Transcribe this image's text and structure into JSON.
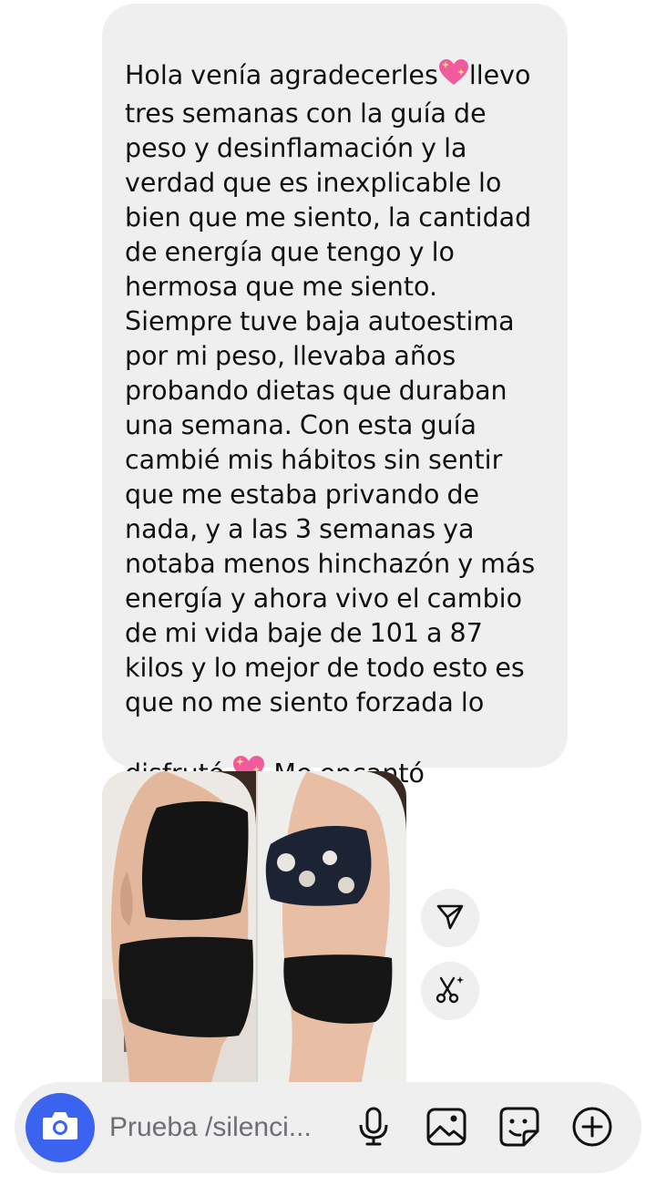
{
  "message": {
    "text_before_emoji1": "Hola venía agradecerles",
    "text_after_emoji1": "llevo\ntres semanas con la guía de\npeso y desinflamación y la\nverdad que es inexplicable lo\nbien que me siento, la cantidad\nde energía que tengo y lo\nhermosa que me siento.\nSiempre tuve baja autoestima\npor mi peso, llevaba años\nprobando dietas que duraban\nuna semana. Con esta guía\ncambié mis hábitos sin sentir\nque me estaba privando de\nnada, y a las 3 semanas ya\nnotaba menos hinchazón y más\nenergía y ahora vivo el cambio\nde mi vida baje de 101 a 87\nkilos y lo mejor de todo esto es\nque no me siento forzada lo\ndisfrutó ",
    "text_after_emoji2": " Me encantó",
    "emoji": "💖",
    "trailing": "—"
  },
  "photo": {
    "icon": "before-after-photo"
  },
  "side_actions": {
    "share_icon": "send-icon",
    "edit_icon": "scissors-sparkle-icon"
  },
  "composer": {
    "placeholder": "Prueba /silenci...",
    "camera_icon": "camera-icon",
    "mic_icon": "microphone-icon",
    "gallery_icon": "image-icon",
    "sticker_icon": "sticker-icon",
    "more_icon": "plus-circle-icon",
    "accent": "#3b63f0"
  }
}
